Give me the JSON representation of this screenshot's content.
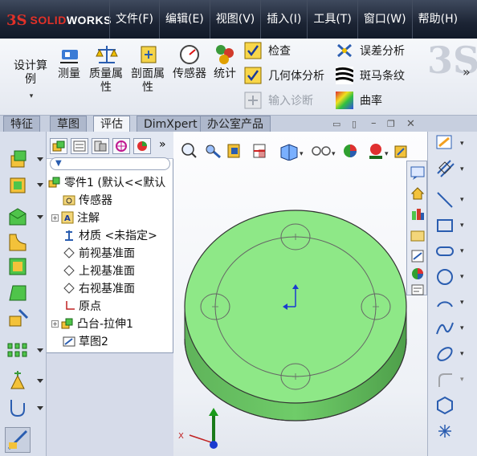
{
  "app": {
    "brand_ds": "3S",
    "brand_solid": "SOLID",
    "brand_works": "WORKS"
  },
  "menu": [
    "文件(F)",
    "编辑(E)",
    "视图(V)",
    "插入(I)",
    "工具(T)",
    "窗口(W)",
    "帮助(H)"
  ],
  "ribbon": {
    "design_study": "设计算例",
    "measure": "测量",
    "mass_props": "质量属性",
    "section_props": "剖面属性",
    "sensor": "传感器",
    "statistics": "统计",
    "check": "检查",
    "geometry_analysis": "几何体分析",
    "import_diagnostics": "输入诊断",
    "deviation_analysis": "误差分析",
    "zebra_stripes": "斑马条纹",
    "curvature": "曲率"
  },
  "tabs": [
    "特征",
    "草图",
    "评估",
    "DimXpert",
    "办公室产品"
  ],
  "active_tab": "评估",
  "tree": {
    "root": "零件1 (默认<<默认",
    "items": [
      "传感器",
      "注解",
      "材质 <未指定>",
      "前视基准面",
      "上视基准面",
      "右视基准面",
      "原点",
      "凸台-拉伸1",
      "草图2"
    ]
  },
  "colors": {
    "part_face": "#8ee887",
    "part_side": "#6fc669",
    "accent": "#e23128"
  }
}
